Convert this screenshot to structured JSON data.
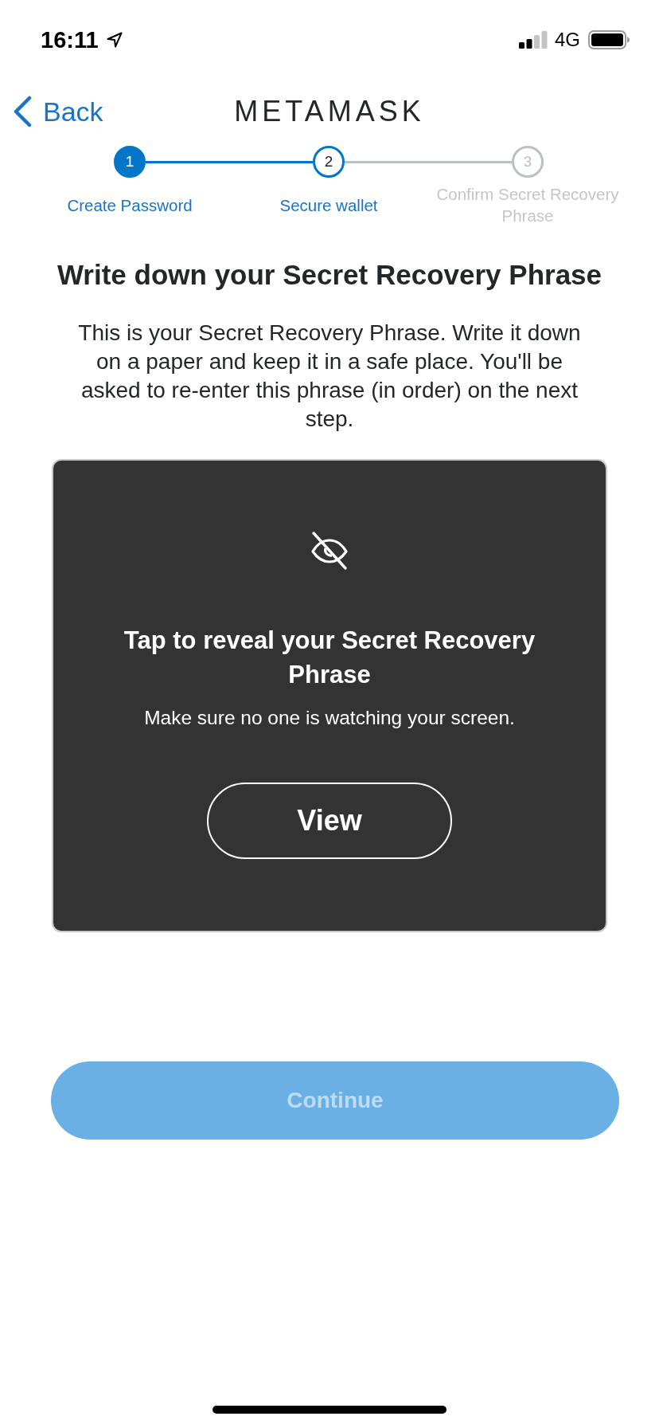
{
  "status_bar": {
    "time": "16:11",
    "network": "4G"
  },
  "header": {
    "back": "Back",
    "title": "METAMASK"
  },
  "steps": [
    {
      "number": "1",
      "label": "Create Password",
      "completed": true,
      "selected": false
    },
    {
      "number": "2",
      "label": "Secure wallet",
      "completed": false,
      "selected": true
    },
    {
      "number": "3",
      "label": "Confirm Secret Recovery Phrase",
      "completed": false,
      "selected": false
    }
  ],
  "heading": "Write down your Secret Recovery Phrase",
  "description": "This is your Secret Recovery Phrase. Write it down on a paper and keep it in a safe place. You'll be asked to re-enter this phrase (in order) on the next step.",
  "reveal_card": {
    "title": "Tap to reveal your Secret Recovery Phrase",
    "subtitle": "Make sure no one is watching your screen.",
    "button": "View"
  },
  "continue_button": {
    "label": "Continue",
    "disabled": true
  }
}
